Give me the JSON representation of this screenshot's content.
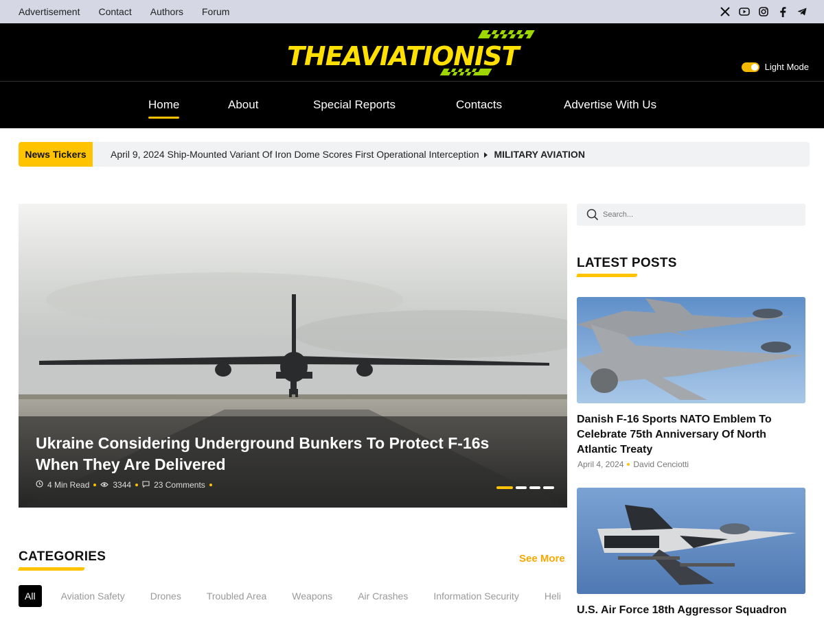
{
  "topbar": {
    "links": [
      "Advertisement",
      "Contact",
      "Authors",
      "Forum"
    ],
    "social_icons": [
      "x-icon",
      "youtube-icon",
      "instagram-icon",
      "facebook-icon",
      "telegram-icon"
    ]
  },
  "masthead": {
    "logo_text": "THEAVIATIONIST",
    "mode_label": "Light Mode"
  },
  "nav": {
    "items": [
      "Home",
      "About",
      "Special Reports",
      "Contacts",
      "Advertise With Us"
    ],
    "active": "Home"
  },
  "ticker": {
    "label": "News Tickers",
    "text": "April 9, 2024 Ship-Mounted Variant Of Iron Dome Scores First Operational Interception",
    "category": "MILITARY AVIATION"
  },
  "hero": {
    "title": "Ukraine Considering Underground Bunkers To Protect F-16s When They Are Delivered",
    "read_time": "4 Min Read",
    "views": "3344",
    "comments": "23 Comments",
    "slides": 4,
    "active_slide": 1
  },
  "search": {
    "placeholder": "Search..."
  },
  "latest": {
    "heading": "LATEST POSTS",
    "posts": [
      {
        "title": "Danish F-16 Sports NATO Emblem To Celebrate 75th Anniversary Of North Atlantic Treaty",
        "date": "April 4, 2024",
        "author": "David Cenciotti"
      },
      {
        "title": "U.S. Air Force 18th Aggressor Squadron"
      }
    ]
  },
  "categories": {
    "heading": "CATEGORIES",
    "see_more": "See More",
    "items": [
      "All",
      "Aviation Safety",
      "Drones",
      "Troubled Area",
      "Weapons",
      "Air Crashes",
      "Information Security",
      "Heli"
    ]
  },
  "colors": {
    "accent": "#ffc300",
    "dark": "#000000",
    "topbar": "#d5d7e4",
    "see_more": "#f5a800"
  }
}
